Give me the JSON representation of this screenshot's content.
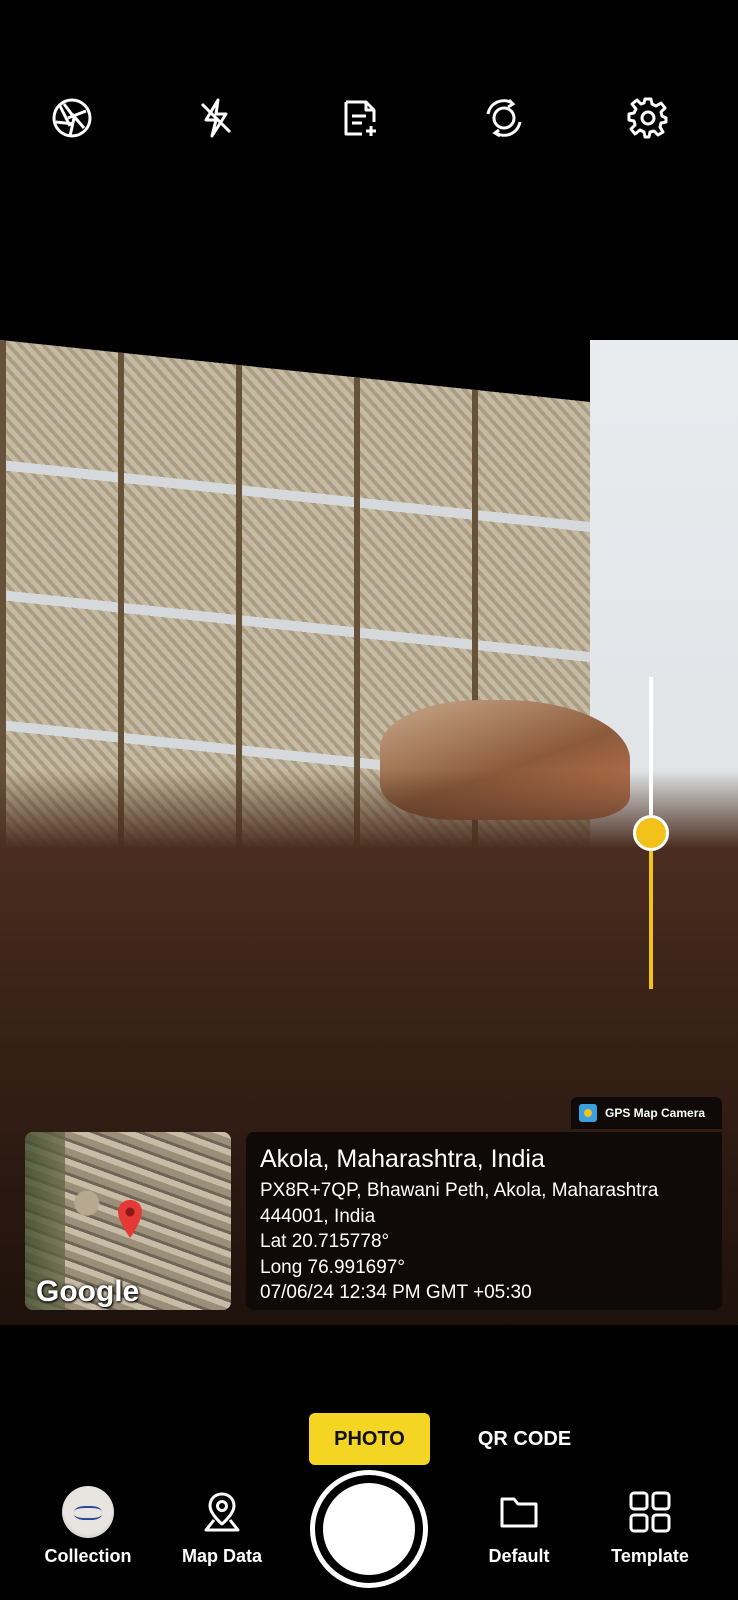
{
  "top_toolbar": {
    "icons": [
      "shutter-aperture-icon",
      "flash-off-icon",
      "add-note-icon",
      "switch-camera-icon",
      "settings-icon"
    ]
  },
  "viewfinder": {
    "zoom_level": 0.49
  },
  "overlay": {
    "brand": "GPS Map Camera",
    "map_attribution": "Google",
    "location_title": "Akola, Maharashtra, India",
    "address_line1": "PX8R+7QP, Bhawani Peth, Akola, Maharashtra",
    "address_line2": "444001, India",
    "lat": "Lat 20.715778°",
    "long": "Long 76.991697°",
    "datetime": "07/06/24 12:34 PM GMT +05:30"
  },
  "modes": {
    "photo": "PHOTO",
    "qr": "QR CODE",
    "active": "PHOTO"
  },
  "bottom_nav": {
    "collection": "Collection",
    "map_data": "Map Data",
    "default": "Default",
    "template": "Template"
  },
  "colors": {
    "accent": "#f5d524",
    "zoom": "#f2c21b",
    "background": "#000000",
    "card": "#0f0a08",
    "pin": "#e53935"
  }
}
